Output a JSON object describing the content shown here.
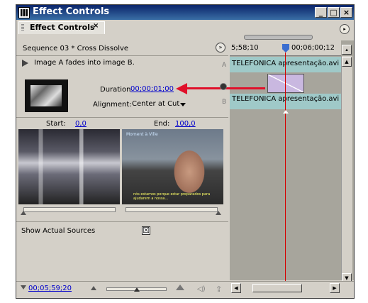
{
  "window": {
    "title": "Effect Controls",
    "controls": {
      "minimize": "_",
      "maximize": "□",
      "close": "×"
    }
  },
  "tab": {
    "label": "Effect Controls",
    "close": "×"
  },
  "panel_menu": "▸",
  "sequence": {
    "name": "Sequence 03 * Cross Dissolve",
    "toggle": "»"
  },
  "effect": {
    "description": "Image A fades into image B.",
    "duration_label": "Duration",
    "duration_value": "00;00;01;00",
    "alignment_label": "Alignment:",
    "alignment_value": "Center at Cut"
  },
  "range": {
    "start_label": "Start:",
    "start_value": "0,0",
    "end_label": "End:",
    "end_value": "100,0",
    "start_fraction": 0.0,
    "end_fraction": 1.0
  },
  "preview_b": {
    "overlay_top": "Moment à Ville",
    "overlay_bottom": "nós estamos porque estar preparados para ajudarem a nossa..."
  },
  "show_actual_sources": {
    "label": "Show Actual Sources",
    "checked": "☒"
  },
  "timeline": {
    "time_left": "5;58;10",
    "time_right": "00;06;00;12",
    "track_a_letter": "A",
    "track_a_clip": "TELEFONICA apresentação.avi",
    "track_b_letter": "B",
    "track_b_clip": "TELEFONICA apresentação.avi"
  },
  "bottom": {
    "current_time": "00;05;59;20",
    "audio": "◁)",
    "export": "⇪"
  },
  "scroll": {
    "up": "▲",
    "down": "▼",
    "left": "◀",
    "right": "▶",
    "top": "▴"
  },
  "colors": {
    "title_bar": "#0a246a",
    "track": "#9fc9c8",
    "transition": "#c9b8e0",
    "playhead": "#d40000",
    "annotation_arrow": "#e0102a",
    "link": "#0000cc"
  }
}
